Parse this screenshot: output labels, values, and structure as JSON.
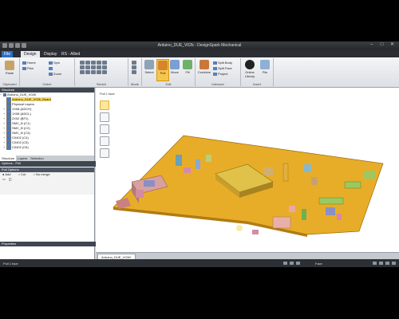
{
  "window": {
    "title": "Arduino_DUE_V02b - DesignSpark Mechanical"
  },
  "tabs": [
    {
      "label": "File"
    },
    {
      "label": "Design"
    },
    {
      "label": "Display"
    },
    {
      "label": "RS - Allied"
    }
  ],
  "ribbon": {
    "clipboard": {
      "paste": "Paste",
      "group": "Clipboard"
    },
    "orient": {
      "home": "Home",
      "spin": "Spin",
      "plan": "Plan",
      "zoom": "Zoom",
      "group": "Orient"
    },
    "sketch": {
      "group": "Sketch"
    },
    "mode": {
      "group": "Mode"
    },
    "edit": {
      "select": "Select",
      "pull": "Pull",
      "move": "Move",
      "fill": "Fill",
      "group": "Edit"
    },
    "intersect": {
      "combine": "Combine",
      "split_body": "Split Body",
      "split_face": "Split Face",
      "project": "Project",
      "group": "Intersect"
    },
    "insert": {
      "online_library": "Online Library",
      "file": "File",
      "group": "Insert"
    }
  },
  "structure": {
    "header": "Structure",
    "items": [
      {
        "label": "Arduino_DUE_V02b"
      },
      {
        "label": "Arduino_DUE_V02b_Board"
      },
      {
        "label": "Physical Layers"
      },
      {
        "label": "1X08 (ADCH)"
      },
      {
        "label": "1X08 (ADCL)"
      },
      {
        "label": "2X02 (BF1)"
      },
      {
        "label": "SMC_B (C1)"
      },
      {
        "label": "SMC_B (C2)"
      },
      {
        "label": "SMC_B (C3)"
      },
      {
        "label": "C0402 (C4)"
      },
      {
        "label": "C0402 (C5)"
      },
      {
        "label": "C0402 (C6)"
      }
    ]
  },
  "panel_tabs": [
    "Structure",
    "Layers",
    "Selection"
  ],
  "options": {
    "header": "Options - Pull",
    "pull_options": "Pull Options",
    "add": "Add",
    "cut": "Cut",
    "no_merge": "No merge"
  },
  "properties": {
    "header": "Properties"
  },
  "viewport": {
    "label": "Pull 1 face"
  },
  "document_tab": "Arduino_DUE_V02b*",
  "status": {
    "message": "Pull 1 face",
    "selection_filter": "Face"
  },
  "colors": {
    "board": "#e8ad28",
    "chrome_dark": "#2b2e33",
    "active_tool": "#f6c64c",
    "file_tab": "#2e6fc0"
  },
  "icons": [
    "paste-icon",
    "home-icon",
    "spin-icon",
    "select-icon",
    "pull-icon",
    "move-icon",
    "fill-icon",
    "combine-icon",
    "online-library-icon",
    "file-icon"
  ]
}
